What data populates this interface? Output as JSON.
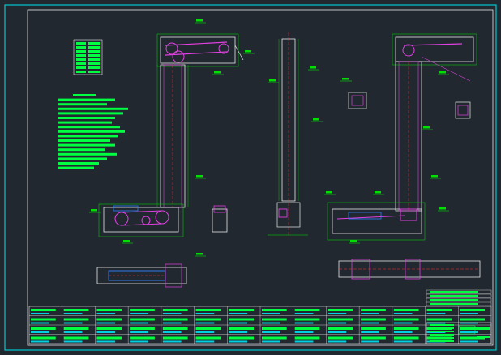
{
  "drawing": {
    "background": "#212830",
    "colors": {
      "frame": "#00c8d0",
      "line": "#e8e8e8",
      "dim": "#00e000",
      "accent": "#e040e0",
      "red": "#ff3030",
      "yellow": "#f0f000",
      "blue": "#3080ff",
      "cyan": "#00d0e0",
      "text": "#00ff40"
    }
  },
  "parts_table": {
    "rows": 4,
    "columns": 14
  },
  "title_block": {
    "cells": 6
  }
}
